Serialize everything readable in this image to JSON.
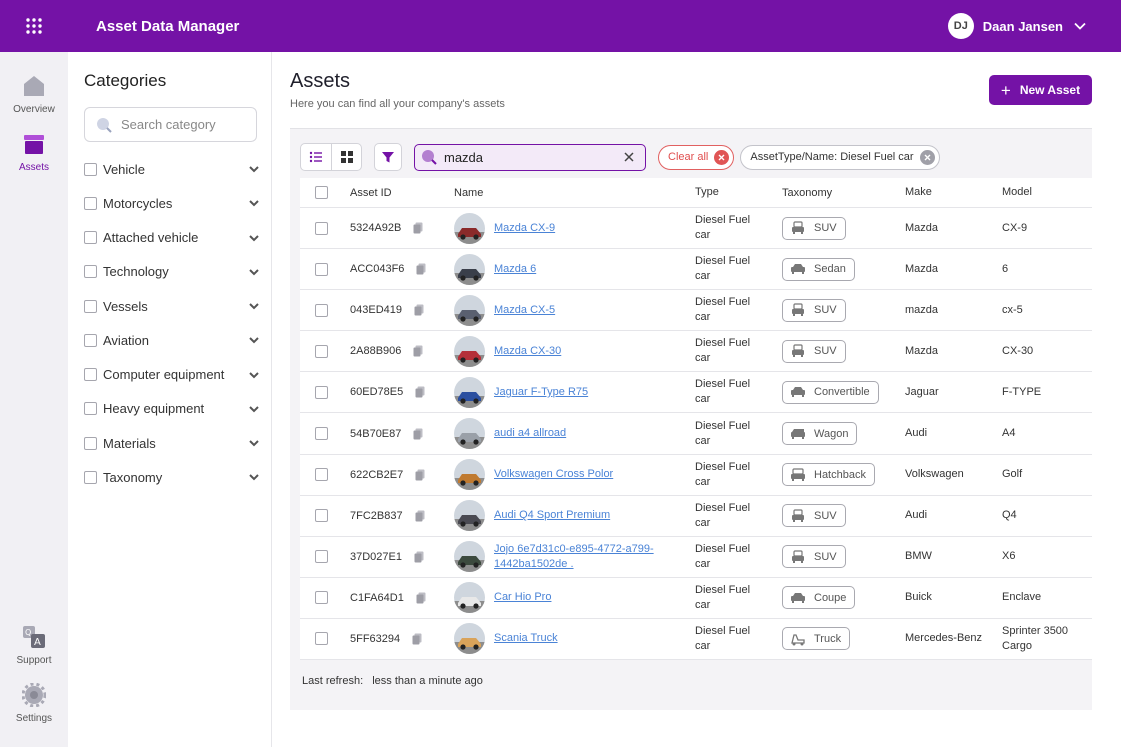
{
  "app": {
    "title": "Asset Data Manager"
  },
  "user": {
    "initials": "DJ",
    "name": "Daan Jansen"
  },
  "rail": [
    {
      "key": "overview",
      "label": "Overview",
      "icon": "home-icon"
    },
    {
      "key": "assets",
      "label": "Assets",
      "icon": "box-icon",
      "active": true
    },
    {
      "key": "support",
      "label": "Support",
      "icon": "qa-icon"
    },
    {
      "key": "settings",
      "label": "Settings",
      "icon": "gear-icon"
    }
  ],
  "categories": {
    "title": "Categories",
    "search_placeholder": "Search category",
    "items": [
      {
        "label": "Vehicle"
      },
      {
        "label": "Motorcycles"
      },
      {
        "label": "Attached vehicle"
      },
      {
        "label": "Technology"
      },
      {
        "label": "Vessels"
      },
      {
        "label": "Aviation"
      },
      {
        "label": "Computer equipment"
      },
      {
        "label": "Heavy equipment"
      },
      {
        "label": "Materials"
      },
      {
        "label": "Taxonomy"
      }
    ]
  },
  "page": {
    "title": "Assets",
    "subtitle": "Here you can find all your company's assets",
    "new_asset_label": "New Asset"
  },
  "toolbar": {
    "search_value": "mazda",
    "clear_all_label": "Clear all",
    "filter_chip_label": "AssetType/Name: Diesel Fuel car"
  },
  "table": {
    "headers": {
      "asset_id": "Asset ID",
      "name": "Name",
      "type": "Type",
      "taxonomy": "Taxonomy",
      "make": "Make",
      "model": "Model"
    },
    "rows": [
      {
        "asset_id": "5324A92B",
        "name": "Mazda CX-9",
        "type": "Diesel Fuel car",
        "taxonomy": "SUV",
        "tax_icon": "suv-icon",
        "make": "Mazda",
        "model": "CX-9",
        "thumb_color": "#8a2a2a"
      },
      {
        "asset_id": "ACC043F6",
        "name": "Mazda 6",
        "type": "Diesel Fuel car",
        "taxonomy": "Sedan",
        "tax_icon": "sedan-icon",
        "make": "Mazda",
        "model": "6",
        "thumb_color": "#3a3f4a"
      },
      {
        "asset_id": "043ED419",
        "name": "Mazda CX-5",
        "type": "Diesel Fuel car",
        "taxonomy": "SUV",
        "tax_icon": "suv-icon",
        "make": "mazda",
        "model": "cx-5",
        "thumb_color": "#5a6070"
      },
      {
        "asset_id": "2A88B906",
        "name": "Mazda CX-30",
        "type": "Diesel Fuel car",
        "taxonomy": "SUV",
        "tax_icon": "suv-icon",
        "make": "Mazda",
        "model": "CX-30",
        "thumb_color": "#b5303a"
      },
      {
        "asset_id": "60ED78E5",
        "name": "Jaguar F-Type R75",
        "type": "Diesel Fuel car",
        "taxonomy": "Convertible",
        "tax_icon": "convertible-icon",
        "make": "Jaguar",
        "model": "F-TYPE",
        "thumb_color": "#2a4fa0"
      },
      {
        "asset_id": "54B70E87",
        "name": "audi a4 allroad",
        "type": "Diesel Fuel car",
        "taxonomy": "Wagon",
        "tax_icon": "wagon-icon",
        "make": "Audi",
        "model": "A4",
        "thumb_color": "#9aa0a8"
      },
      {
        "asset_id": "622CB2E7",
        "name": "Volkswagen Cross Polor",
        "type": "Diesel Fuel car",
        "taxonomy": "Hatchback",
        "tax_icon": "hatchback-icon",
        "make": "Volkswagen",
        "model": "Golf",
        "thumb_color": "#c07a30"
      },
      {
        "asset_id": "7FC2B837",
        "name": "Audi Q4 Sport Premium",
        "type": "Diesel Fuel car",
        "taxonomy": "SUV",
        "tax_icon": "suv-icon",
        "make": "Audi",
        "model": "Q4",
        "thumb_color": "#4a4a52"
      },
      {
        "asset_id": "37D027E1",
        "name": "Jojo 6e7d31c0-e895-4772-a799-1442ba1502de .",
        "type": "Diesel Fuel car",
        "taxonomy": "SUV",
        "tax_icon": "suv-icon",
        "make": "BMW",
        "model": "X6",
        "thumb_color": "#3c4a3e"
      },
      {
        "asset_id": "C1FA64D1",
        "name": "Car Hio Pro",
        "type": "Diesel Fuel car",
        "taxonomy": "Coupe",
        "tax_icon": "coupe-icon",
        "make": "Buick",
        "model": "Enclave",
        "thumb_color": "#e8e8e8"
      },
      {
        "asset_id": "5FF63294",
        "name": "Scania Truck",
        "type": "Diesel Fuel car",
        "taxonomy": "Truck",
        "tax_icon": "truck-icon",
        "make": "Mercedes-Benz",
        "model": "Sprinter 3500 Cargo",
        "thumb_color": "#d9a35a"
      }
    ]
  },
  "footer": {
    "refresh_label": "Last refresh:",
    "refresh_value": "less than a minute ago"
  },
  "colors": {
    "primary": "#7412a6",
    "link": "#4a83d6",
    "danger": "#e05555"
  }
}
